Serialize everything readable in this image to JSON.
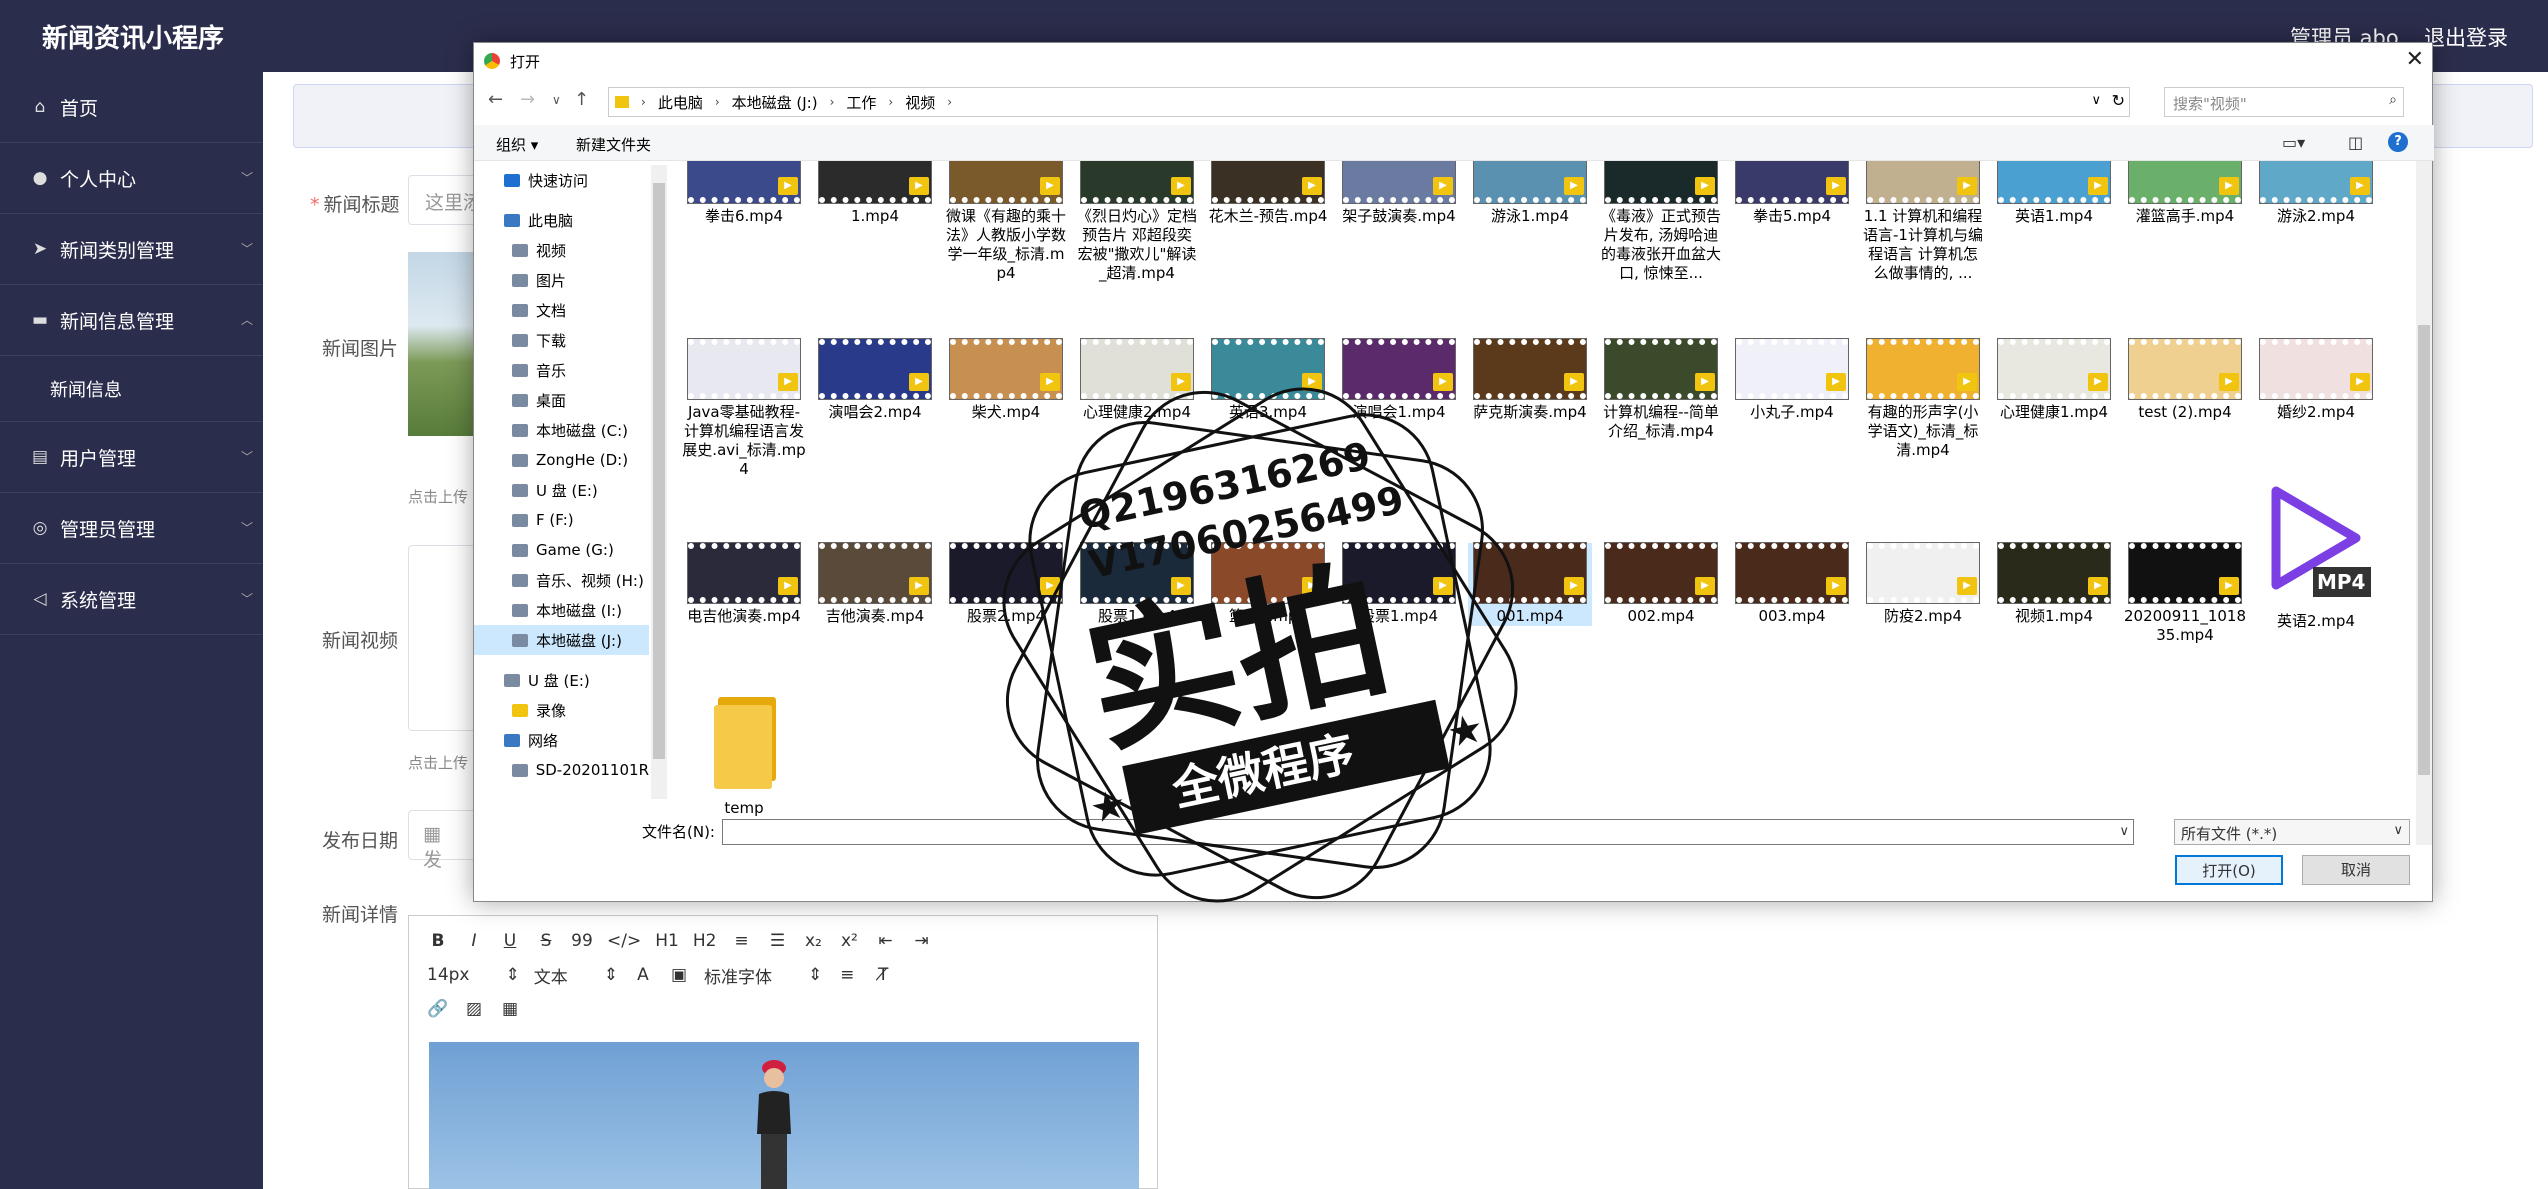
{
  "app": {
    "title": "新闻资讯小程序",
    "admin": "管理员 abo",
    "logout": "退出登录"
  },
  "sidebar": {
    "items": [
      {
        "label": "首页",
        "icon": "home-icon"
      },
      {
        "label": "个人中心",
        "icon": "user-icon"
      },
      {
        "label": "新闻类别管理",
        "icon": "send-icon"
      },
      {
        "label": "新闻信息管理",
        "icon": "monitor-icon"
      },
      {
        "label": "新闻信息",
        "icon": ""
      },
      {
        "label": "用户管理",
        "icon": "db-icon"
      },
      {
        "label": "管理员管理",
        "icon": "admin-icon"
      },
      {
        "label": "系统管理",
        "icon": "nav-icon"
      }
    ]
  },
  "form": {
    "title_label": "新闻标题",
    "title_placeholder": "这里添",
    "image_label": "新闻图片",
    "image_hint": "点击上传",
    "video_label": "新闻视频",
    "video_hint": "点击上传",
    "date_label": "发布日期",
    "date_placeholder": "发",
    "detail_label": "新闻详情"
  },
  "editor": {
    "font_size": "14px",
    "text_type": "文本",
    "font_family": "标准字体",
    "buttons": [
      "B",
      "I",
      "U",
      "S",
      "99",
      "</>",
      "H1",
      "H2"
    ]
  },
  "dialog": {
    "title": "打开",
    "breadcrumb": [
      "此电脑",
      "本地磁盘 (J:)",
      "工作",
      "视频"
    ],
    "search_placeholder": "搜索\"视频\"",
    "organize": "组织 ▾",
    "new_folder": "新建文件夹",
    "nav_items": [
      {
        "label": "快速访问",
        "indent": 1
      },
      {
        "label": "此电脑",
        "indent": 1
      },
      {
        "label": "视频",
        "indent": 2
      },
      {
        "label": "图片",
        "indent": 2
      },
      {
        "label": "文档",
        "indent": 2
      },
      {
        "label": "下载",
        "indent": 2
      },
      {
        "label": "音乐",
        "indent": 2
      },
      {
        "label": "桌面",
        "indent": 2
      },
      {
        "label": "本地磁盘 (C:)",
        "indent": 2
      },
      {
        "label": "ZongHe (D:)",
        "indent": 2
      },
      {
        "label": "U 盘 (E:)",
        "indent": 2
      },
      {
        "label": "F (F:)",
        "indent": 2
      },
      {
        "label": "Game (G:)",
        "indent": 2
      },
      {
        "label": "音乐、视频 (H:)",
        "indent": 2
      },
      {
        "label": "本地磁盘 (I:)",
        "indent": 2
      },
      {
        "label": "本地磁盘 (J:)",
        "indent": 2,
        "selected": true
      },
      {
        "label": "U 盘 (E:)",
        "indent": 1
      },
      {
        "label": "录像",
        "indent": 2
      },
      {
        "label": "网络",
        "indent": 1
      },
      {
        "label": "SD-20201101R",
        "indent": 2
      }
    ],
    "files": [
      {
        "name": "拳击6.mp4",
        "color": "#3a4a8a"
      },
      {
        "name": "1.mp4",
        "color": "#2b2b2b"
      },
      {
        "name": "微课《有趣的乘十法》人教版小学数学一年级_标清.mp4",
        "color": "#7a5a2a"
      },
      {
        "name": "《烈日灼心》定档预告片 邓超段奕宏被\"撒欢儿\"解读_超清.mp4",
        "color": "#2a3a2a"
      },
      {
        "name": "花木兰-预告.mp4",
        "color": "#3b3024"
      },
      {
        "name": "架子鼓演奏.mp4",
        "color": "#6a7aa0"
      },
      {
        "name": "游泳1.mp4",
        "color": "#5a90b0"
      },
      {
        "name": "《毒液》正式预告片发布, 汤姆哈迪的毒液张开血盆大口, 惊悚至...",
        "color": "#1a2a2a"
      },
      {
        "name": "拳击5.mp4",
        "color": "#3a3a6a"
      },
      {
        "name": "1.1 计算机和编程语言-1计算机与编程语言 计算机怎么做事情的, ...",
        "color": "#c0b090"
      },
      {
        "name": "英语1.mp4",
        "color": "#4aa0d0"
      },
      {
        "name": "灌篮高手.mp4",
        "color": "#6ab06a"
      },
      {
        "name": "游泳2.mp4",
        "color": "#60a8c8"
      },
      {
        "name": "Java零基础教程-计算机编程语言发展史.avi_标清.mp4",
        "color": "#e8e8f0"
      },
      {
        "name": "演唱会2.mp4",
        "color": "#2a3a8a"
      },
      {
        "name": "柴犬.mp4",
        "color": "#c89050"
      },
      {
        "name": "心理健康2.mp4",
        "color": "#e0e0d8"
      },
      {
        "name": "英语3.mp4",
        "color": "#3a8a9a"
      },
      {
        "name": "演唱会1.mp4",
        "color": "#5a2a6a"
      },
      {
        "name": "萨克斯演奏.mp4",
        "color": "#5a3a1a"
      },
      {
        "name": "计算机编程--简单介绍_标清.mp4",
        "color": "#3a4a2a"
      },
      {
        "name": "小丸子.mp4",
        "color": "#f0f0f8"
      },
      {
        "name": "有趣的形声字(小学语文)_标清_标清.mp4",
        "color": "#f0b030"
      },
      {
        "name": "心理健康1.mp4",
        "color": "#e8e8e0"
      },
      {
        "name": "test (2).mp4",
        "color": "#f0d090"
      },
      {
        "name": "婚纱2.mp4",
        "color": "#f0e0e0"
      },
      {
        "name": "电吉他演奏.mp4",
        "color": "#2a2a3a"
      },
      {
        "name": "吉他演奏.mp4",
        "color": "#5a4a3a"
      },
      {
        "name": "股票2.mp4",
        "color": "#1a1a2a"
      },
      {
        "name": "股票1.mp4",
        "color": "#1a2a3a"
      },
      {
        "name": "篮球1.mp4",
        "color": "#8a4a2a"
      },
      {
        "name": "股票1.mp4",
        "color": "#1a1a2a"
      },
      {
        "name": "001.mp4",
        "color": "#4a2a1a"
      },
      {
        "name": "002.mp4",
        "color": "#4a2a1a"
      },
      {
        "name": "003.mp4",
        "color": "#4a2a1a"
      },
      {
        "name": "防疫2.mp4",
        "color": "#f0f0f0"
      },
      {
        "name": "视频1.mp4",
        "color": "#2a2a1a"
      },
      {
        "name": "20200911_101835.mp4",
        "color": "#111111"
      },
      {
        "name": "英语2.mp4",
        "color": ""
      },
      {
        "name": "temp",
        "color": ""
      }
    ],
    "filename_label": "文件名(N):",
    "filename_value": "",
    "filetype": "所有文件 (*.*)",
    "open_button": "打开(O)",
    "cancel_button": "取消"
  },
  "watermark": {
    "phone1": "Q2196316269",
    "phone2": "V17060256499",
    "big": "实拍",
    "ribbon": "全微程序"
  },
  "colors": {
    "sidebar": "#2b2d4c",
    "accent": "#0078d7",
    "required": "#f56c6c",
    "mp4_icon": "#7b3fe4"
  }
}
